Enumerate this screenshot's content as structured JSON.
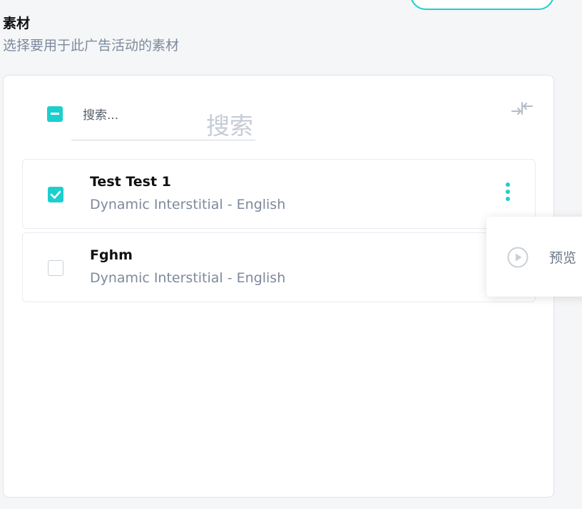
{
  "section": {
    "title": "素材",
    "subtitle": "选择要用于此广告活动的素材"
  },
  "search": {
    "placeholder": "搜索...",
    "label": "搜索"
  },
  "items": [
    {
      "name": "Test Test 1",
      "description": "Dynamic Interstitial - English",
      "checked": true
    },
    {
      "name": "Fghm",
      "description": "Dynamic Interstitial - English",
      "checked": false
    }
  ],
  "menu": {
    "preview_label": "预览"
  },
  "icons": {
    "select_all": "minus-checkbox-icon",
    "collapse": "collapse-arrows-icon",
    "more": "vertical-dots-icon",
    "preview": "play-circle-icon"
  },
  "colors": {
    "accent": "#1ccfcf",
    "muted_text": "#7d8a9c",
    "border": "#dfe3ea"
  }
}
